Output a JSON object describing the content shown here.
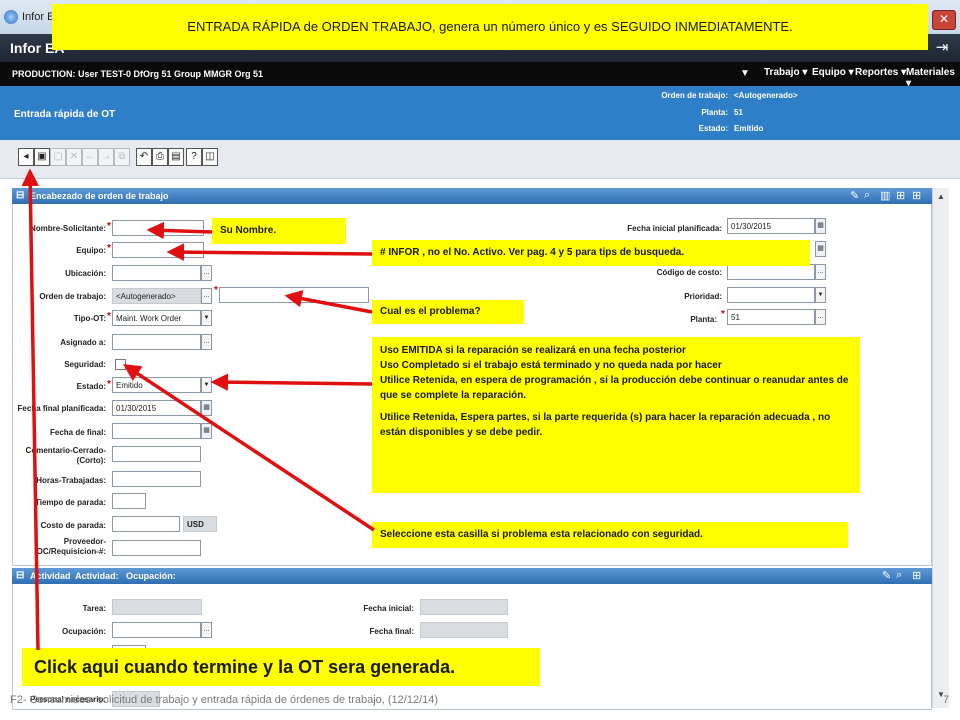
{
  "window": {
    "title": "Infor EA",
    "close_glyph": "✕",
    "app_brand": "Infor EA"
  },
  "userbar": {
    "info": "PRODUCTION: User TEST-0 DfOrg 51 Group MMGR Org 51",
    "menus": [
      "Trabajo",
      "Equipo",
      "Reportes",
      "Materiales"
    ]
  },
  "pageheader": {
    "title": "Entrada rápida de OT",
    "fields": [
      {
        "label": "Orden de trabajo:",
        "value": "<Autogenerado>"
      },
      {
        "label": "Planta:",
        "value": "51"
      },
      {
        "label": "Estado:",
        "value": "Emitido"
      }
    ]
  },
  "section1": {
    "title": "Encabezado de orden de trabajo",
    "left": [
      {
        "label": "Nombre-Solicitante:",
        "required": true,
        "value": ""
      },
      {
        "label": "Equipo:",
        "required": true,
        "value": ""
      },
      {
        "label": "Ubicación:",
        "required": false,
        "value": ""
      },
      {
        "label": "Orden de trabajo:",
        "required": false,
        "value": "<Autogenerado>"
      },
      {
        "label": "Tipo-OT:",
        "required": true,
        "value": "Maint. Work Order"
      },
      {
        "label": "Asignado a:",
        "required": false,
        "value": ""
      },
      {
        "label": "Seguridad:",
        "required": false,
        "value": ""
      },
      {
        "label": "Estado:",
        "required": true,
        "value": "Emitido"
      },
      {
        "label": "Fecha final planificada:",
        "required": false,
        "value": "01/30/2015"
      },
      {
        "label": "Fecha de final:",
        "required": false,
        "value": ""
      },
      {
        "label": "Comentario-Cerrado-(Corto):",
        "required": false,
        "value": ""
      },
      {
        "label": "Horas-Trabajadas:",
        "required": false,
        "value": ""
      },
      {
        "label": "Tiempo de parada:",
        "required": false,
        "value": ""
      },
      {
        "label": "Costo de parada:",
        "required": false,
        "value": "",
        "unit": "USD"
      },
      {
        "label": "Proveedor-OC/Requisicion-#:",
        "required": false,
        "value": ""
      }
    ],
    "right": [
      {
        "label": "Fecha inicial planificada:",
        "required": false,
        "value": "01/30/2015"
      },
      {
        "label": "Código de costo:",
        "required": false,
        "value": ""
      },
      {
        "label": "Prioridad:",
        "required": false,
        "value": ""
      },
      {
        "label": "Planta:",
        "required": true,
        "value": "51"
      }
    ]
  },
  "section2": {
    "title": "Actividad  Actividad:   Ocupación:",
    "left": [
      {
        "label": "Tarea:",
        "value": ""
      },
      {
        "label": "Ocupación:",
        "value": ""
      },
      {
        "label": "Personal necesario:",
        "value": ""
      }
    ],
    "right": [
      {
        "label": "Fecha inicial:",
        "value": ""
      },
      {
        "label": "Fecha final:",
        "value": ""
      }
    ]
  },
  "callouts": {
    "top": "ENTRADA RÁPIDA  de ORDEN TRABAJO, genera un número único y es SEGUIDO INMEDIATAMENTE.",
    "nombre": "Su Nombre.",
    "equipo": "# INFOR , no el No. Activo. Ver pag. 4 y 5 para tips de busqueda.",
    "problema": "Cual es el problema?",
    "estado": [
      "Uso EMITIDA si la reparación se realizará en una fecha posterior",
      "Uso Completado si el trabajo está terminado y no queda nada por hacer",
      "Utilice Retenida, en espera de programación , si la producción debe continuar o reanudar antes de que se complete la reparación.",
      "Utilice Retenida, Espera partes,  si la parte requerida (s) para hacer la reparación adecuada ,  no están disponibles y se debe pedir."
    ],
    "seguridad": "Seleccione esta casilla si problema esta relacionado con seguridad.",
    "click": "Click aqui cuando termine y la OT sera generada."
  },
  "footer": {
    "text": "F2- Consumidos- solicitud de trabajo y entrada rápida de órdenes de trabajo, (12/12/14)",
    "page": "7"
  },
  "colors": {
    "callout": "#ffff00",
    "arrow": "#e01010",
    "header_blue": "#2f7fc8",
    "section_blue": "#2f6fb3"
  }
}
